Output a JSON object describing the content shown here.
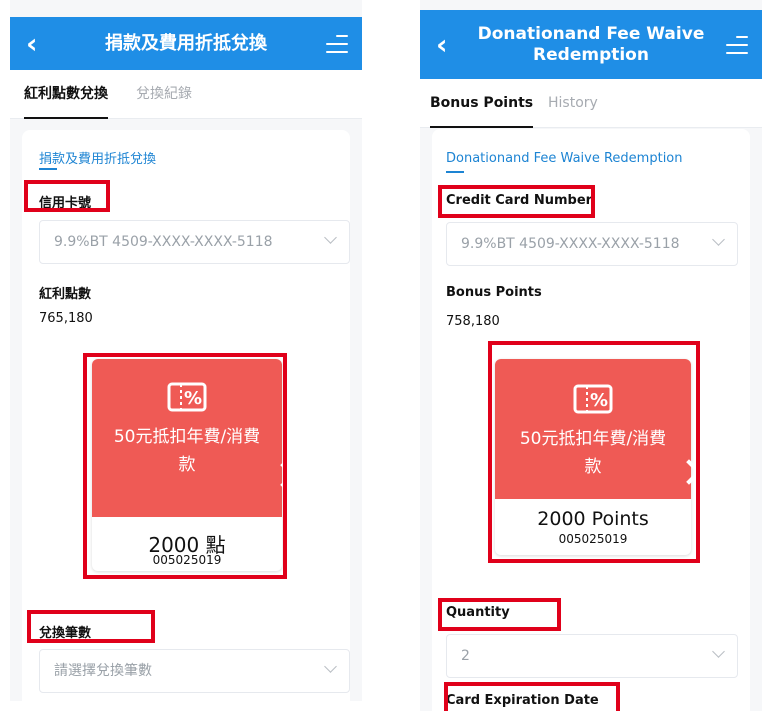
{
  "left": {
    "header": {
      "title": "捐款及費用折抵兌換"
    },
    "tabs": [
      {
        "label": "紅利點數兌換"
      },
      {
        "label": "兌換紀錄"
      }
    ],
    "section_title": "捐款及費用折抵兌換",
    "credit_card_label": "信用卡號",
    "credit_card_value": "9.9%BT 4509-XXXX-XXXX-5118",
    "bonus_label": "紅利點數",
    "bonus_value": "765,180",
    "item": {
      "name_line1": "50元抵扣年費/消費",
      "name_line2": "款",
      "points": "2000 點",
      "code": "005025019"
    },
    "quantity_label": "兌換筆數",
    "quantity_placeholder": "請選擇兌換筆數"
  },
  "right": {
    "header": {
      "title_line1": "Donationand Fee Waive",
      "title_line2": "Redemption"
    },
    "tabs": [
      {
        "label": "Bonus Points"
      },
      {
        "label": "History"
      }
    ],
    "section_title": "Donationand Fee Waive Redemption",
    "credit_card_label": "Credit Card Number",
    "credit_card_value": "9.9%BT 4509-XXXX-XXXX-5118",
    "bonus_label": "Bonus Points",
    "bonus_value": "758,180",
    "item": {
      "name_line1": "50元抵扣年費/消費",
      "name_line2": "款",
      "points": "2000 Points",
      "code": "005025019"
    },
    "quantity_label": "Quantity",
    "quantity_value": "2",
    "expiration_label": "Card Expiration Date"
  },
  "icons": {
    "back": "back-arrow-icon",
    "menu": "menu-icon",
    "chevron": "chevron-down-icon",
    "coupon": "coupon-percent-icon",
    "next": "chevron-right-icon"
  },
  "colors": {
    "header": "#1f8ee6",
    "accent": "#1d84d3",
    "item": "#ef5a55",
    "highlight": "#e0001a"
  }
}
